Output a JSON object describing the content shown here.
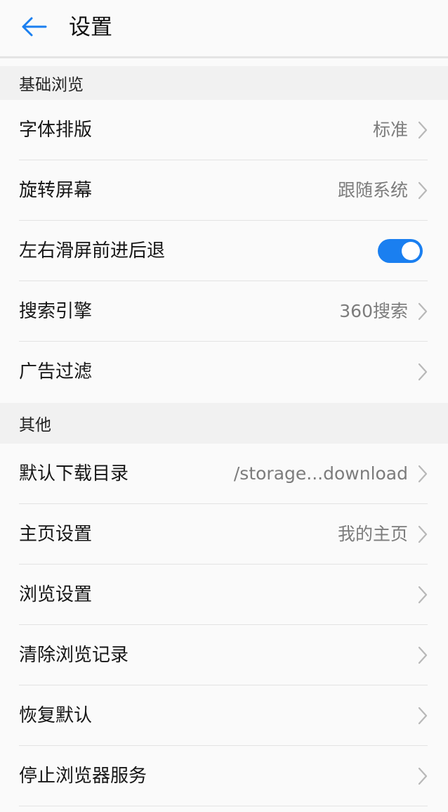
{
  "header": {
    "title": "设置",
    "back_icon": "arrow-left-icon",
    "accent_color": "#1a7ff0"
  },
  "sections": [
    {
      "title": "基础浏览",
      "items": [
        {
          "label": "字体排版",
          "value": "标准"
        },
        {
          "label": "旋转屏幕",
          "value": "跟随系统"
        },
        {
          "label": "左右滑屏前进后退",
          "toggle": true
        },
        {
          "label": "搜索引擎",
          "value": "360搜索"
        },
        {
          "label": "广告过滤",
          "value": ""
        }
      ]
    },
    {
      "title": "其他",
      "items": [
        {
          "label": "默认下载目录",
          "value": "/storage...download"
        },
        {
          "label": "主页设置",
          "value": "我的主页"
        },
        {
          "label": "浏览设置",
          "value": ""
        },
        {
          "label": "清除浏览记录",
          "value": ""
        },
        {
          "label": "恢复默认",
          "value": ""
        },
        {
          "label": "停止浏览器服务",
          "value": ""
        }
      ]
    }
  ],
  "icons": {
    "chevron": "chevron-right-icon",
    "toggle_on_color": "#1a7ff0"
  }
}
